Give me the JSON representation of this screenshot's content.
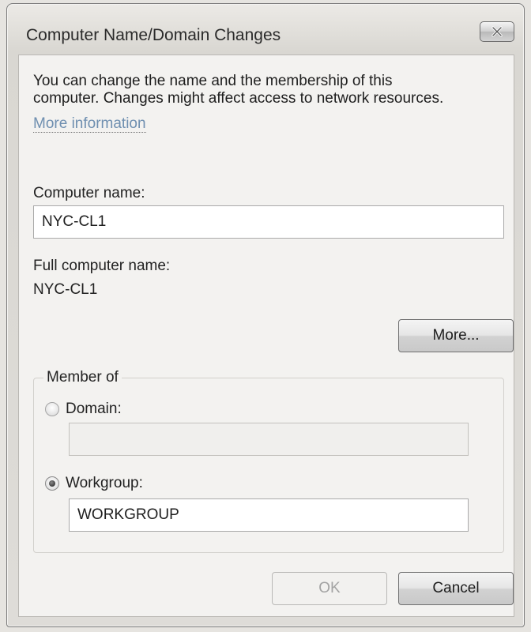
{
  "window": {
    "title": "Computer Name/Domain Changes",
    "close_symbol": "✕"
  },
  "description": {
    "line1": "You can change the name and the membership of this",
    "line2": "computer. Changes might affect access to network resources.",
    "link": "More information"
  },
  "computer_name": {
    "label": "Computer name:",
    "value": "NYC-CL1"
  },
  "full_computer_name": {
    "label": "Full computer name:",
    "value": "NYC-CL1"
  },
  "buttons": {
    "more": "More...",
    "ok": "OK",
    "cancel": "Cancel"
  },
  "member_of": {
    "legend": "Member of",
    "selected": "workgroup",
    "domain": {
      "label": "Domain:",
      "value": ""
    },
    "workgroup": {
      "label": "Workgroup:",
      "value": "WORKGROUP"
    }
  },
  "icons": {
    "close": "close-icon"
  },
  "colors": {
    "link": "#6f8fb0",
    "disabled_text": "#a3a3a3"
  }
}
